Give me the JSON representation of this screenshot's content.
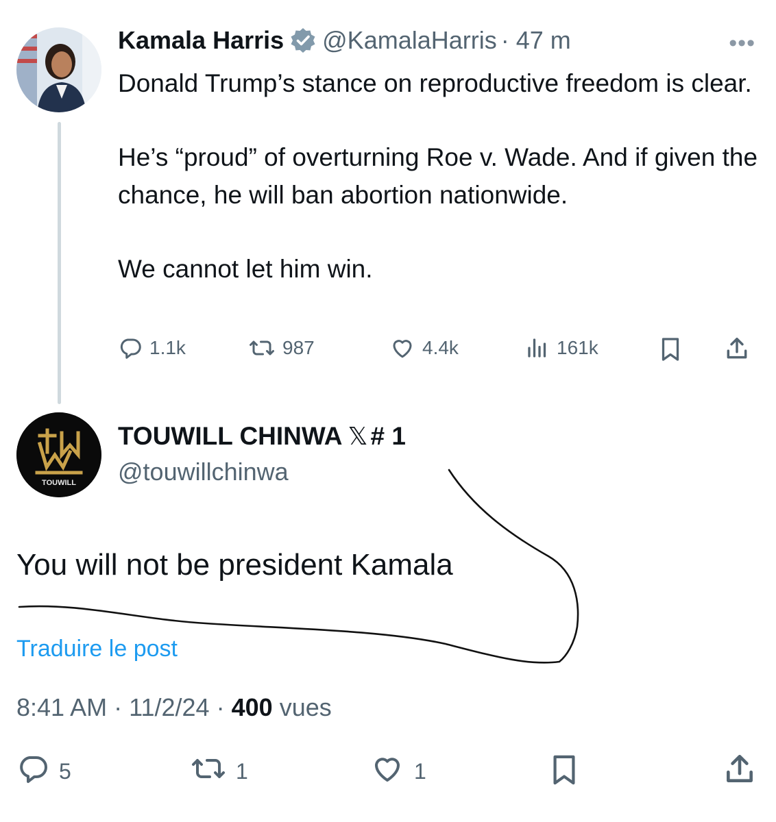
{
  "parent_tweet": {
    "author_name": "Kamala Harris",
    "author_handle": "@KamalaHarris",
    "time_ago": "· 47 m",
    "more_label": "•••",
    "paragraphs": [
      "Donald Trump’s stance on reproductive freedom is clear.",
      "He’s “proud” of overturning Roe v. Wade. And if given the chance, he will ban abortion nationwide.",
      "We cannot let him win."
    ],
    "stats": {
      "replies": "1.1k",
      "reposts": "987",
      "likes": "4.4k",
      "views": "161k"
    },
    "icons": [
      "verified-badge-icon",
      "reply-icon",
      "repost-icon",
      "like-icon",
      "views-icon",
      "bookmark-icon",
      "share-icon"
    ]
  },
  "reply_tweet": {
    "author_name": "TOUWILL CHINWA",
    "name_suffix_x": "𝕏",
    "name_suffix_rank": "# 1",
    "author_handle": "@touwillchinwa",
    "avatar_logo_text": "TOUWILL",
    "text": "You will not be president Kamala",
    "translate_link": "Traduire le post",
    "meta": {
      "time": "8:41 AM",
      "separator": "·",
      "date": "11/2/24",
      "views_count": "400",
      "views_label": "vues"
    },
    "stats": {
      "replies": "5",
      "reposts": "1",
      "likes": "1"
    }
  },
  "colors": {
    "text": "#0f1419",
    "secondary": "#536471",
    "link": "#1d9bf0",
    "verified": "#829aab",
    "thread_line": "#cfd9de",
    "avatar_gold": "#c9a24a"
  }
}
